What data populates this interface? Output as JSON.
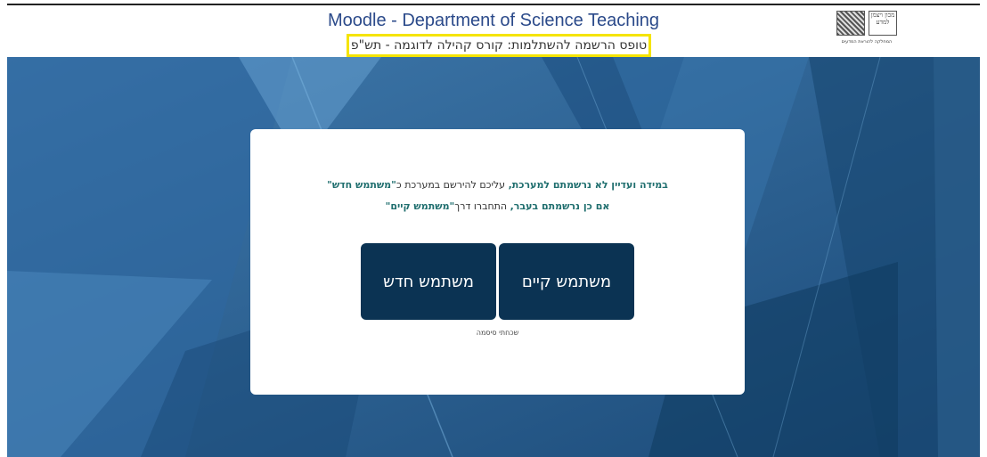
{
  "header": {
    "site_title": "Moodle - Department of Science Teaching",
    "course_title": "טופס הרשמה להשתלמות: קורס קהילה לדוגמה - תש\"פ",
    "logo": {
      "text": "מכון ויצמן למדע",
      "caption": "המחלקה להוראת המדעים"
    }
  },
  "card": {
    "line1_part1": "במידה ועדיין לא נרשמתם למערכת,",
    "line1_part2": " עליכם להירשם במערכת כ",
    "line1_part3": "\"משתמש חדש\"",
    "line2_part1": "אם כן נרשמתם בעבר,",
    "line2_part2": " התחברו דרך",
    "line2_part3": "\"משתמש קיים\"",
    "existing_user_label": "משתמש קיים",
    "new_user_label": "משתמש חדש",
    "forgot_password_label": "שכחתי סיסמה"
  },
  "colors": {
    "background_blue": "#265a8c",
    "button_navy": "#0b3353",
    "highlight_border": "#f5e400",
    "title_blue": "#2b4a8a"
  }
}
